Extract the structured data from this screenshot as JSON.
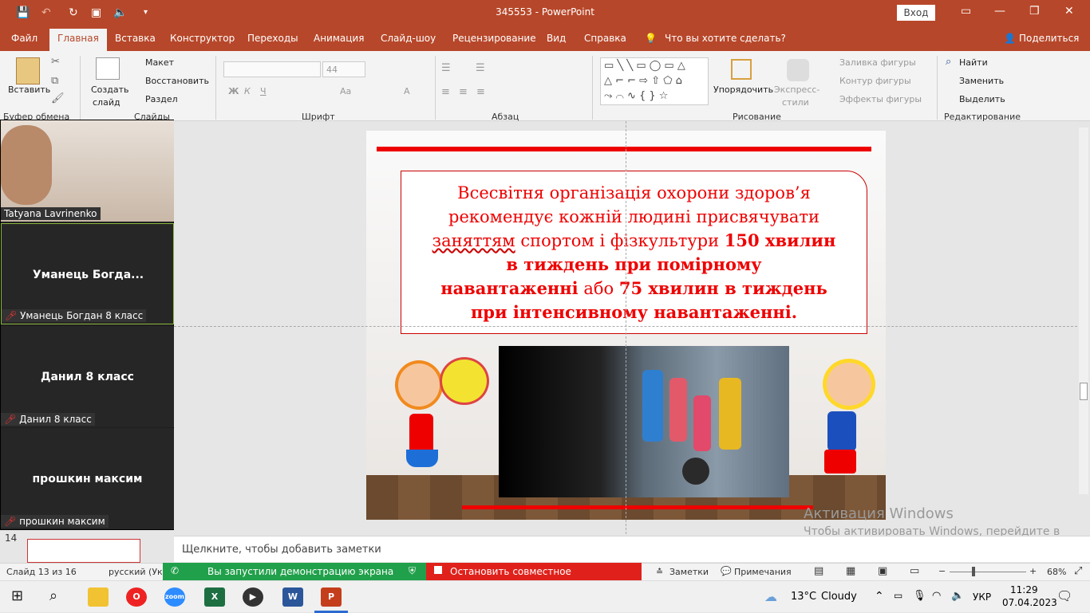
{
  "titlebar": {
    "title": "345553  -  PowerPoint",
    "signin": "Вход"
  },
  "tabs": [
    "Файл",
    "Главная",
    "Вставка",
    "Конструктор",
    "Переходы",
    "Анимация",
    "Слайд-шоу",
    "Рецензирование",
    "Вид",
    "Справка",
    "Что вы хотите сделать?"
  ],
  "share": "Поделиться",
  "ribbon": {
    "paste": "Вставить",
    "clipboard": "Буфер обмена",
    "new_slide_1": "Создать",
    "new_slide_2": "слайд",
    "layout": "Макет",
    "reset": "Восстановить",
    "section": "Раздел",
    "slides": "Слайды",
    "font_size": "44",
    "font": "Шрифт",
    "paragraph": "Абзац",
    "arrange": "Упорядочить",
    "quick_styles_1": "Экспресс-",
    "quick_styles_2": "стили",
    "shape_fill": "Заливка фигуры",
    "shape_outline": "Контур фигуры",
    "shape_effects": "Эффекты фигуры",
    "drawing": "Рисование",
    "find": "Найти",
    "replace": "Заменить",
    "select": "Выделить",
    "editing": "Редактирование"
  },
  "slide": {
    "l1": "Всесвітня організація охорони здоров’я",
    "l2": "рекомендує кожній людині присвячувати",
    "l3a": "заняттям",
    "l3b": " спортом і фізкультури ",
    "l3c": "150 хвилин",
    "l4": "в тиждень при помірному",
    "l5a": "навантаженні",
    "l5b": " або ",
    "l5c": "75 хвилин в тиждень",
    "l6": "при інтенсивному навантаженні."
  },
  "participants": [
    {
      "name": "",
      "label": "Tatyana Lavrinenko"
    },
    {
      "name": "Уманець  Богда...",
      "label": "Уманець Богдан 8 класс"
    },
    {
      "name": "Данил 8 класс",
      "label": "Данил 8 класс"
    },
    {
      "name": "прошкин максим",
      "label": "прошкин максим"
    }
  ],
  "thumb_number": "14",
  "notes_placeholder": "Щелкните, чтобы добавить заметки",
  "status": {
    "slide": "Слайд 13 из 16",
    "lang": "русский (Укр",
    "notes": "Заметки",
    "comments": "Примечания",
    "zoom": "68%"
  },
  "share_bar": {
    "green": "Вы запустили демонстрацию экрана",
    "red": "Остановить совместное использование"
  },
  "watermark": {
    "title": "Активация Windows",
    "text": "Чтобы активировать Windows, перейдите в раздел \"Параметры\"."
  },
  "taskbar": {
    "temp": "13°C",
    "weather": "Cloudy",
    "lang": "УКР",
    "time": "11:29",
    "date": "07.04.2023"
  },
  "colors": {
    "accent": "#b7472a",
    "slide_text": "#e00000",
    "share_green": "#21a04b",
    "share_red": "#e0211b"
  }
}
